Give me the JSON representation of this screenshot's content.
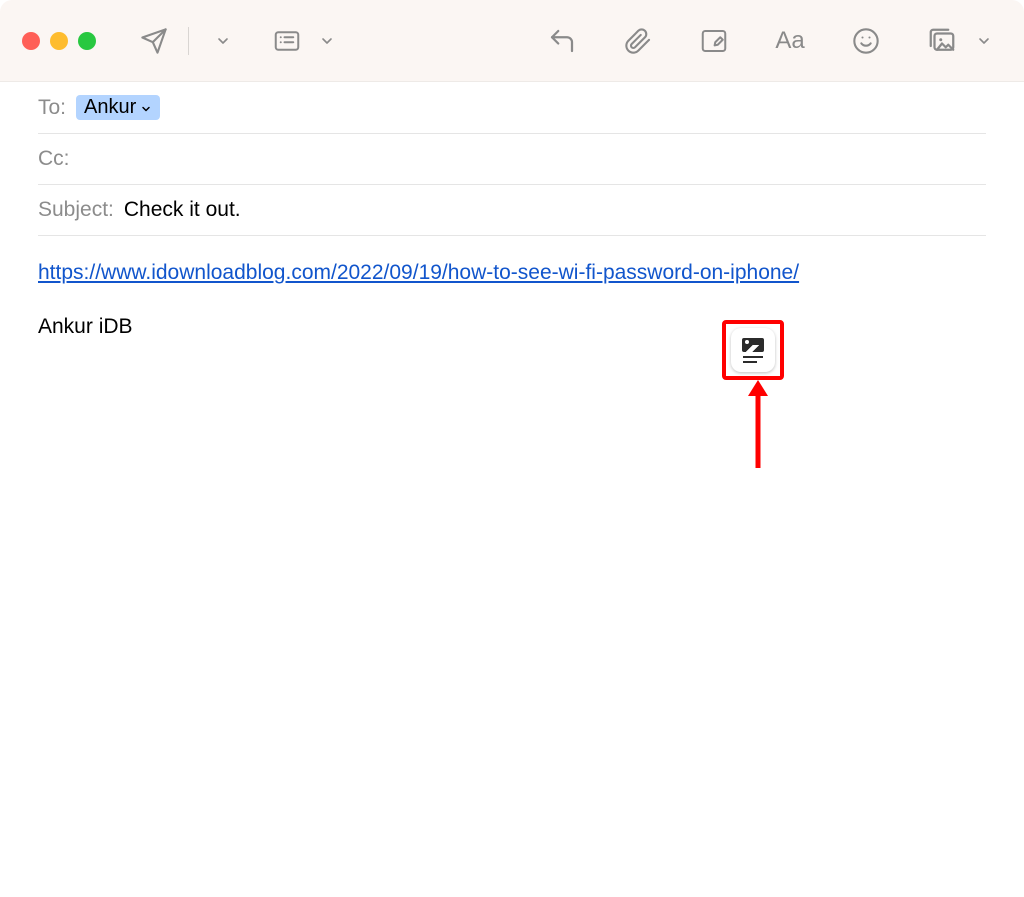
{
  "fields": {
    "to_label": "To:",
    "to_recipient": "Ankur",
    "cc_label": "Cc:",
    "subject_label": "Subject:",
    "subject_value": "Check it out."
  },
  "body": {
    "link_text": "https://www.idownloadblog.com/2022/09/19/how-to-see-wi-fi-password-on-iphone/",
    "signature": "Ankur iDB"
  }
}
